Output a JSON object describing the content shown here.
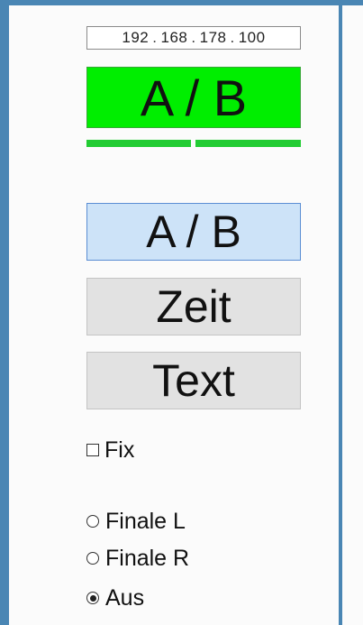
{
  "ip_address": {
    "octet1": "192",
    "octet2": "168",
    "octet3": "178",
    "octet4": "100",
    "separator": "."
  },
  "status_display": {
    "label": "A / B",
    "color": "#00ee00"
  },
  "buttons": {
    "ab_label": "A / B",
    "zeit_label": "Zeit",
    "text_label": "Text"
  },
  "options": {
    "fix_label": "Fix",
    "fix_checked": false,
    "radio_finale_l_label": "Finale L",
    "radio_finale_r_label": "Finale R",
    "radio_aus_label": "Aus",
    "radio_selected": "Aus"
  }
}
